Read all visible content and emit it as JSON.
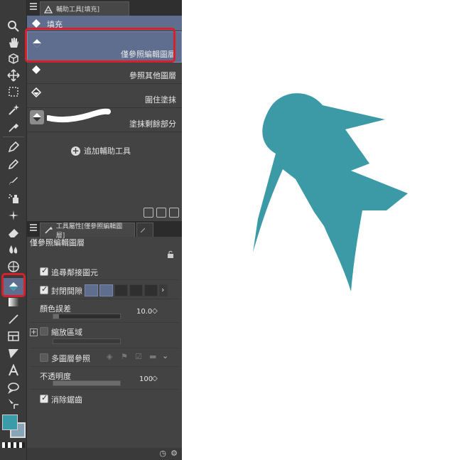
{
  "colors": {
    "panel": "#434343",
    "toolbar": "#3a3a3a",
    "selected": "#5f6d8f",
    "highlight": "#d6202a",
    "shape": "#3c9aa6",
    "main_color": "#3a9ca8",
    "sub_color": "#88a4b8"
  },
  "tools": [
    "magnifier-icon",
    "hand-icon",
    "move-layer-icon",
    "transform-icon",
    "selection-icon",
    "magic-wand-icon",
    "eyedropper-icon",
    "pen-icon",
    "pencil-icon",
    "brush-icon",
    "airbrush-icon",
    "decoration-icon",
    "eraser-icon",
    "blend-icon",
    "figure-icon",
    "fill-icon",
    "gradient-icon",
    "line-icon",
    "frame-icon",
    "ruler-icon",
    "text-icon",
    "balloon-icon",
    "correct-line-icon"
  ],
  "subtool_panel": {
    "tab_label": "輔助工具[填充]",
    "items": [
      {
        "name": "填充",
        "selected": true
      },
      {
        "name": "僅參照編輯圖層",
        "selected": true
      },
      {
        "name": "參照其他圖層",
        "selected": false
      },
      {
        "name": "圍住塗抹",
        "selected": false
      },
      {
        "name": "塗抹剩餘部分",
        "selected": false
      }
    ],
    "add_label": "追加輔助工具"
  },
  "property_panel": {
    "tab_label": "工具屬性[僅參照編輯圖層]",
    "title": "僅參照編輯圖層",
    "follow_adjacent": {
      "label": "追尋鄰接圖元",
      "checked": true
    },
    "close_gap": {
      "label": "封閉間隙",
      "checked": true
    },
    "color_margin": {
      "label": "顏色誤差",
      "value": "10.0"
    },
    "area_scaling": {
      "label": "縮放區域",
      "checked": false
    },
    "multi_layer": {
      "label": "多圖層參照",
      "checked": false
    },
    "opacity": {
      "label": "不透明度",
      "value": "100"
    },
    "antialias": {
      "label": "消除鋸齒",
      "checked": true
    }
  }
}
